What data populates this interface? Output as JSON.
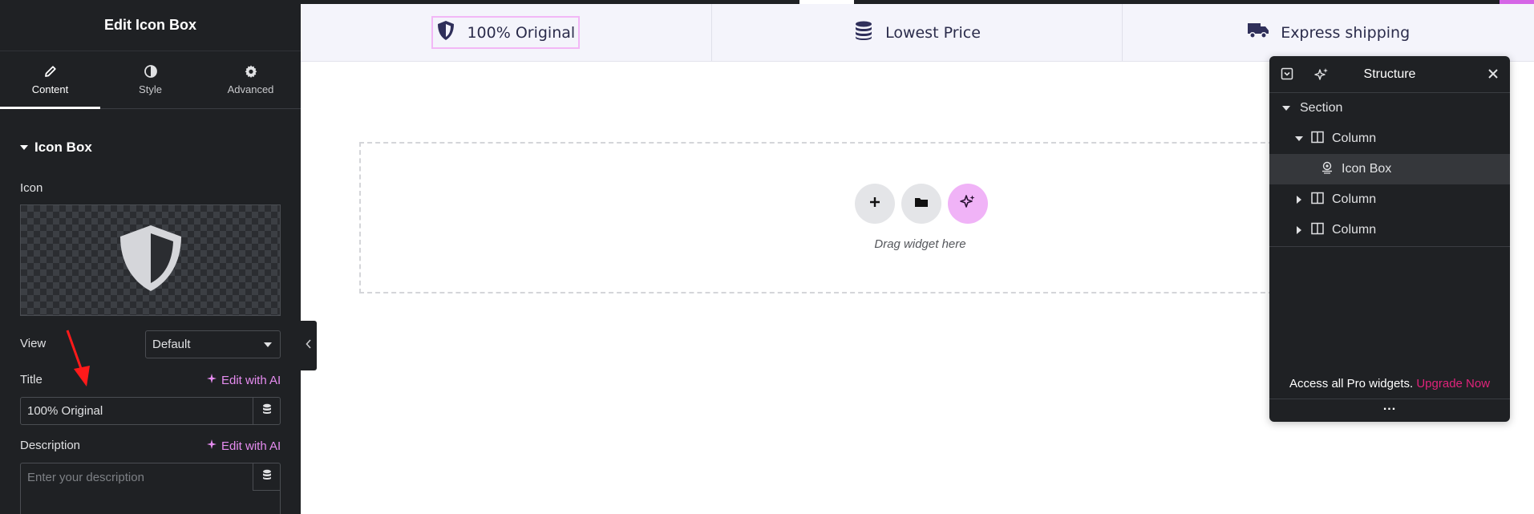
{
  "panel": {
    "title": "Edit Icon Box",
    "tabs": [
      {
        "label": "Content",
        "icon": "pencil-icon"
      },
      {
        "label": "Style",
        "icon": "half-circle-icon"
      },
      {
        "label": "Advanced",
        "icon": "gear-icon"
      }
    ],
    "section_title": "Icon Box",
    "icon_label": "Icon",
    "view_label": "View",
    "view_value": "Default",
    "title_label": "Title",
    "title_value": "100% Original",
    "edit_ai_label": "Edit with AI",
    "description_label": "Description",
    "description_placeholder": "Enter your description"
  },
  "canvas": {
    "features": [
      {
        "label": "100% Original",
        "icon": "shield-icon"
      },
      {
        "label": "Lowest Price",
        "icon": "coins-icon"
      },
      {
        "label": "Express shipping",
        "icon": "truck-icon"
      }
    ],
    "drop_label": "Drag widget here"
  },
  "structure": {
    "title": "Structure",
    "items": [
      {
        "label": "Section"
      },
      {
        "label": "Column"
      },
      {
        "label": "Icon Box"
      },
      {
        "label": "Column"
      },
      {
        "label": "Column"
      }
    ],
    "promo_text": "Access all Pro widgets.",
    "promo_link": "Upgrade Now",
    "more": "..."
  },
  "colors": {
    "panel_bg": "#1f2124",
    "accent_ai": "#e68cf0",
    "upgrade_link": "#e0237b",
    "selected_outline": "#f2b8f6",
    "feature_text": "#2b2c4b"
  }
}
